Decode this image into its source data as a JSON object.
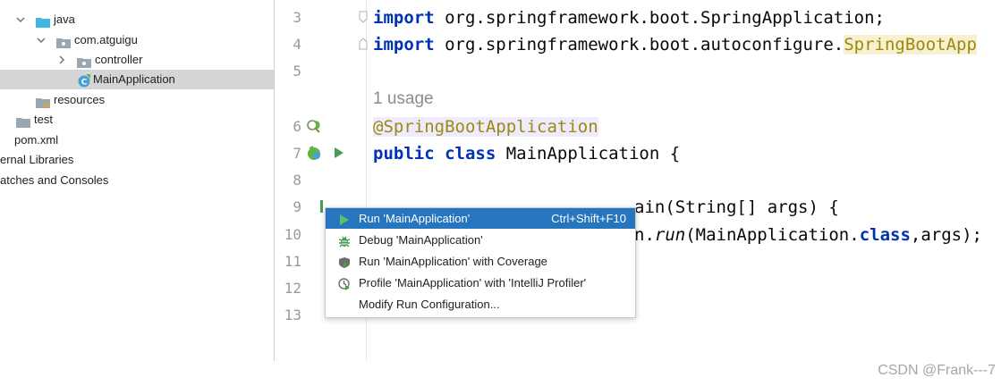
{
  "tree": {
    "items": [
      {
        "label": "java"
      },
      {
        "label": "com.atguigu"
      },
      {
        "label": "controller"
      },
      {
        "label": "MainApplication"
      },
      {
        "label": "resources"
      },
      {
        "label": "test"
      },
      {
        "label": "pom.xml"
      },
      {
        "label": "ernal Libraries"
      },
      {
        "label": "atches and Consoles"
      }
    ]
  },
  "editor": {
    "line_numbers": [
      "3",
      "4",
      "5",
      "6",
      "7",
      "8",
      "9",
      "10",
      "11",
      "12",
      "13"
    ],
    "usage_hint": "1 usage",
    "lines": {
      "l3_kw": "import",
      "l3_rest": " org.springframework.boot.SpringApplication;",
      "l4_kw": "import",
      "l4_rest": " org.springframework.boot.autoconfigure.",
      "l4_class": "SpringBootApp",
      "l6_ann": "@SpringBootApplication",
      "l7_kw1": "public",
      "l7_kw2": " class",
      "l7_rest": " MainApplication {",
      "l9_tail": "ain(String[] args) {",
      "l10_a": "n.",
      "l10_run": "run",
      "l10_b": "(MainApplication.",
      "l10_kw": "class",
      "l10_c": ",args);"
    }
  },
  "popup": {
    "items": [
      {
        "label": "Run 'MainApplication'",
        "shortcut": "Ctrl+Shift+F10",
        "icon": "run-icon"
      },
      {
        "label": "Debug 'MainApplication'",
        "shortcut": "",
        "icon": "debug-icon"
      },
      {
        "label": "Run 'MainApplication' with Coverage",
        "shortcut": "",
        "icon": "coverage-icon"
      },
      {
        "label": "Profile 'MainApplication' with 'IntelliJ Profiler'",
        "shortcut": "",
        "icon": "profiler-icon"
      },
      {
        "label": "Modify Run Configuration...",
        "shortcut": "",
        "icon": ""
      }
    ]
  },
  "watermark": "CSDN @Frank---7",
  "colors": {
    "selection": "#2675bf",
    "keyword": "#0033b3",
    "annotation": "#9e880d",
    "run_green": "#499c54"
  }
}
